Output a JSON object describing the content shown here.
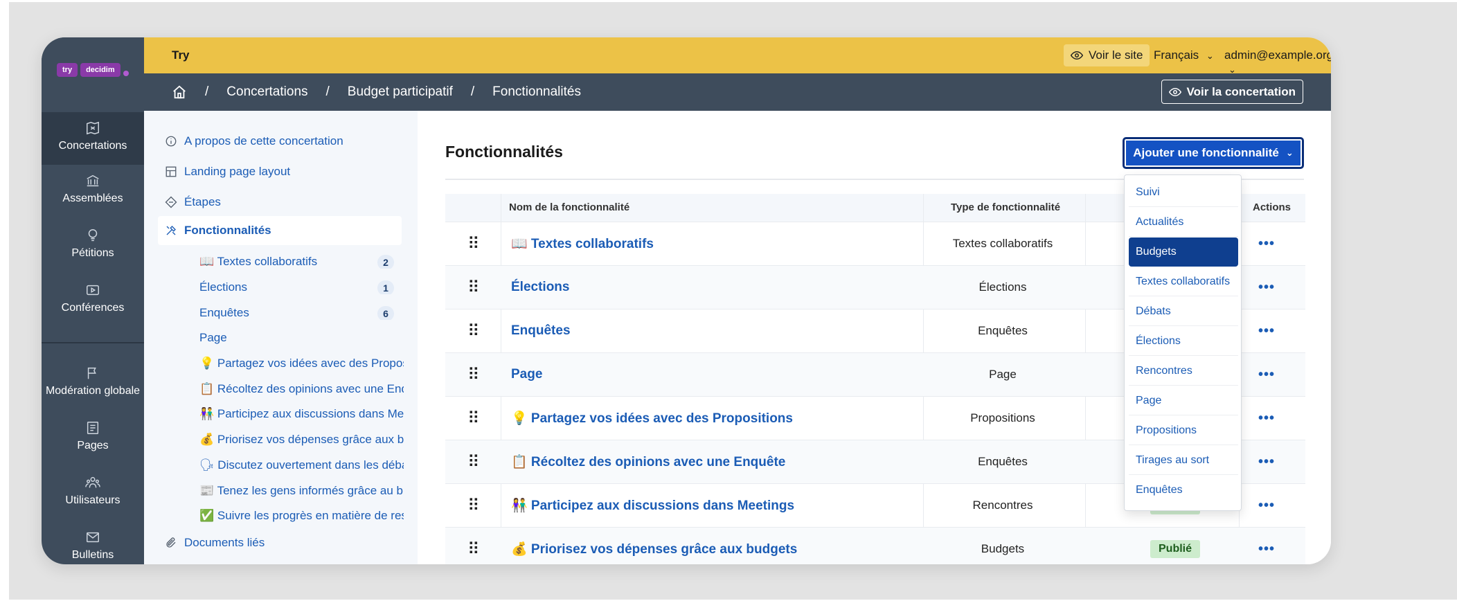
{
  "app": {
    "brand": "Try",
    "logo_parts": [
      "try",
      "decidim"
    ]
  },
  "topbar": {
    "voir_site": "Voir le site",
    "language": "Français",
    "user": "admin@example.org"
  },
  "breadcrumb": [
    "Concertations",
    "Budget participatif",
    "Fonctionnalités"
  ],
  "breadcrumb_action": "Voir la concertation",
  "rail": [
    {
      "label": "Concertations",
      "icon": "concertations-icon"
    },
    {
      "label": "Assemblées",
      "icon": "assemblies-icon"
    },
    {
      "label": "Pétitions",
      "icon": "lightbulb-icon"
    },
    {
      "label": "Conférences",
      "icon": "video-icon"
    },
    {
      "label": "Modération globale",
      "icon": "flag-icon"
    },
    {
      "label": "Pages",
      "icon": "pages-icon"
    },
    {
      "label": "Utilisateurs",
      "icon": "users-icon"
    },
    {
      "label": "Bulletins",
      "icon": "mail-icon"
    }
  ],
  "subnav": {
    "items": [
      {
        "label": "A propos de cette concertation",
        "icon": "info-icon"
      },
      {
        "label": "Landing page layout",
        "icon": "layout-icon"
      },
      {
        "label": "Étapes",
        "icon": "steps-icon"
      },
      {
        "label": "Fonctionnalités",
        "icon": "tools-icon"
      }
    ],
    "children": [
      {
        "label": "📖 Textes collaboratifs",
        "count": "2"
      },
      {
        "label": "Élections",
        "count": "1"
      },
      {
        "label": "Enquêtes",
        "count": "6"
      },
      {
        "label": "Page",
        "count": ""
      },
      {
        "label": "💡 Partagez vos idées avec des Propositions",
        "count": ""
      },
      {
        "label": "📋 Récoltez des opinions avec une Enquête",
        "count": ""
      },
      {
        "label": "👫 Participez aux discussions dans Meetings",
        "count": ""
      },
      {
        "label": "💰 Priorisez vos dépenses grâce aux budgets",
        "count": ""
      },
      {
        "label": "🗣 Discutez ouvertement dans les débats",
        "count": ""
      },
      {
        "label": "📰 Tenez les gens informés grâce au blog",
        "count": ""
      },
      {
        "label": "✅ Suivre les progrès en matière de responsabilité",
        "count": ""
      }
    ],
    "documents": "Documents liés"
  },
  "main": {
    "title": "Fonctionnalités",
    "add_button": "Ajouter une fonctionnalité",
    "columns": {
      "name": "Nom de la fonctionnalité",
      "type": "Type de fonctionnalité",
      "actions": "Actions"
    },
    "rows": [
      {
        "name": "📖 Textes collaboratifs",
        "type": "Textes collaboratifs",
        "status": ""
      },
      {
        "name": "Élections",
        "type": "Élections",
        "status": ""
      },
      {
        "name": "Enquêtes",
        "type": "Enquêtes",
        "status": ""
      },
      {
        "name": "Page",
        "type": "Page",
        "status": ""
      },
      {
        "name": "💡 Partagez vos idées avec des Propositions",
        "type": "Propositions",
        "status": ""
      },
      {
        "name": "📋 Récoltez des opinions avec une Enquête",
        "type": "Enquêtes",
        "status": ""
      },
      {
        "name": "👫 Participez aux discussions dans Meetings",
        "type": "Rencontres",
        "status": "Publié"
      },
      {
        "name": "💰 Priorisez vos dépenses grâce aux budgets",
        "type": "Budgets",
        "status": "Publié"
      }
    ],
    "actions_label": "•••"
  },
  "dropdown": {
    "items": [
      "Suivi",
      "Actualités",
      "Budgets",
      "Textes collaboratifs",
      "Débats",
      "Élections",
      "Rencontres",
      "Page",
      "Propositions",
      "Tirages au sort",
      "Enquêtes"
    ],
    "highlighted": "Budgets"
  }
}
